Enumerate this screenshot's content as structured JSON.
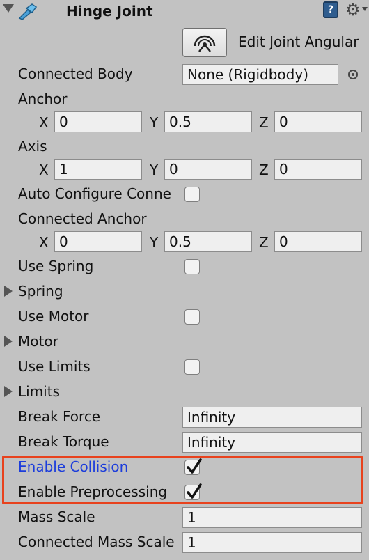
{
  "header": {
    "title": "Hinge Joint",
    "help_glyph": "?",
    "icons": [
      "foldout-arrow-icon",
      "hinge-joint-component-icon",
      "help-book-icon",
      "gear-icon"
    ]
  },
  "edit_joint": {
    "label": "Edit Joint Angular"
  },
  "connected_body": {
    "label": "Connected Body",
    "value": "None (Rigidbody)"
  },
  "anchor": {
    "label": "Anchor",
    "x": "0",
    "y": "0.5",
    "z": "0"
  },
  "axis": {
    "label": "Axis",
    "x": "1",
    "y": "0",
    "z": "0"
  },
  "axis_letters": {
    "x": "X",
    "y": "Y",
    "z": "Z"
  },
  "auto_configure": {
    "label": "Auto Configure Conne",
    "checked": false
  },
  "connected_anchor": {
    "label": "Connected Anchor",
    "x": "0",
    "y": "0.5",
    "z": "0"
  },
  "use_spring": {
    "label": "Use Spring",
    "checked": false
  },
  "spring": {
    "label": "Spring"
  },
  "use_motor": {
    "label": "Use Motor",
    "checked": false
  },
  "motor": {
    "label": "Motor"
  },
  "use_limits": {
    "label": "Use Limits",
    "checked": false
  },
  "limits": {
    "label": "Limits"
  },
  "break_force": {
    "label": "Break Force",
    "value": "Infinity"
  },
  "break_torque": {
    "label": "Break Torque",
    "value": "Infinity"
  },
  "enable_collision": {
    "label": "Enable Collision",
    "checked": true
  },
  "enable_preprocessing": {
    "label": "Enable Preprocessing",
    "checked": true
  },
  "mass_scale": {
    "label": "Mass Scale",
    "value": "1"
  },
  "connected_mass_scale": {
    "label": "Connected Mass Scale",
    "value": "1"
  },
  "colors": {
    "panel_bg": "#c2c2c2",
    "highlight_border": "#e8421d",
    "focus_label": "#1c3ddb",
    "help_icon": "#2f5d8f"
  }
}
